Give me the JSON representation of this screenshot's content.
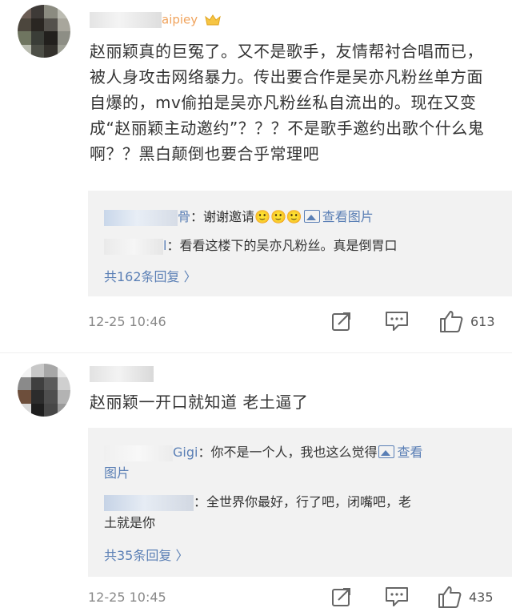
{
  "comments": [
    {
      "username": "aipiey",
      "text": "赵丽颖真的巨冤了。又不是歌手，友情帮衬合唱而已，被人身攻击网络暴力。传出要合作是吴亦凡粉丝单方面自爆的，mv偷拍是吴亦凡粉丝私自流出的。现在又变成“赵丽颖主动邀约”？？？不是歌手邀约出歌个什么鬼啊？？黑白颠倒也要合乎常理吧",
      "replies": [
        {
          "name_suffix": "骨",
          "text": "：谢谢邀请",
          "emoji": "🙂🙂🙂",
          "pic_label": "查看图片"
        },
        {
          "name_suffix": "l",
          "text": "：看看这楼下的吴亦凡粉丝。真是倒胃口"
        }
      ],
      "more": "共162条回复 〉",
      "time": "12-25 10:46",
      "likes": "613"
    },
    {
      "username": "",
      "text": "赵丽颖一开口就知道  老土逼了",
      "replies": [
        {
          "name_suffix": "Gigi",
          "text": "：你不是一个人，我也这么觉得",
          "pic_label": "查看",
          "pic_wrap": "图片"
        },
        {
          "name_suffix": "",
          "text": "：全世界你最好，行了吧，闭嘴吧，老",
          "text2": "土就是你"
        }
      ],
      "more": "共35条回复 〉",
      "time": "12-25 10:45",
      "likes": "435"
    }
  ],
  "icons": {
    "share": "share-icon",
    "comment": "comment-icon",
    "like": "thumbs-up-icon"
  },
  "colors": {
    "link": "#5a7fb5",
    "time": "#888888",
    "reply_bg": "#f2f2f2"
  }
}
